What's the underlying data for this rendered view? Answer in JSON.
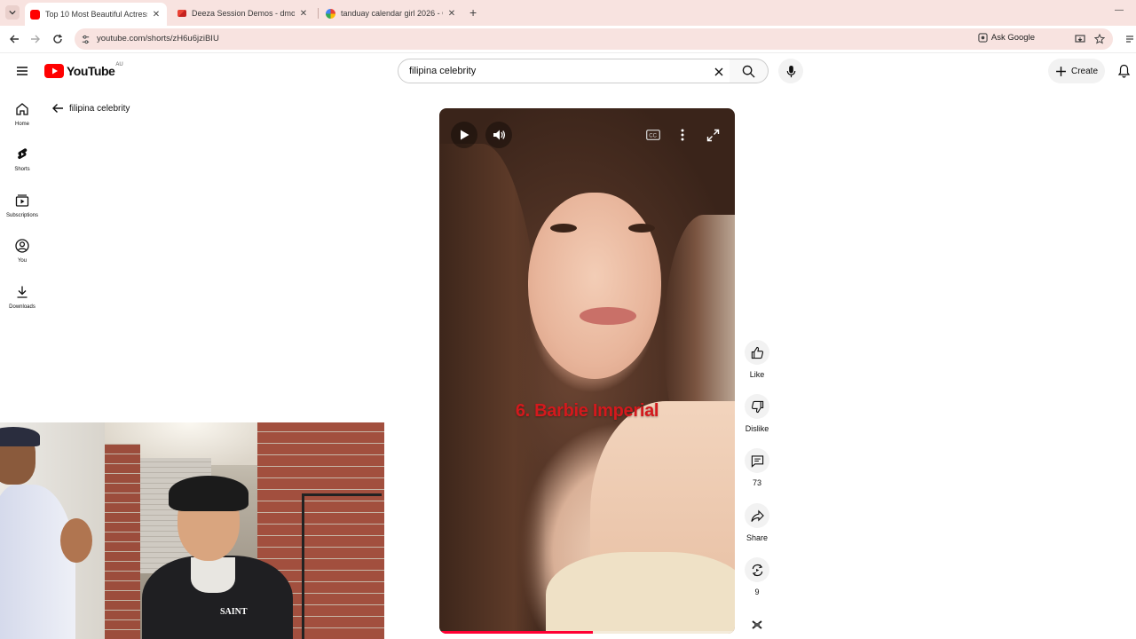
{
  "browser": {
    "tabs": [
      {
        "title": "Top 10 Most Beautiful Actress i",
        "favicon": "youtube-favicon",
        "active": true
      },
      {
        "title": "Deeza Session Demos - dmosu",
        "favicon": "gmail-favicon",
        "active": false
      },
      {
        "title": "tanduay calendar girl 2026 - Go",
        "favicon": "google-favicon",
        "active": false
      }
    ],
    "url": "youtube.com/shorts/zH6u6jziBIU",
    "ask_google_label": "Ask Google"
  },
  "header": {
    "logo_text": "YouTube",
    "logo_country": "AU",
    "search_value": "filipina celebrity",
    "create_label": "Create"
  },
  "sidebar": {
    "items": [
      {
        "label": "Home",
        "icon": "home-icon"
      },
      {
        "label": "Shorts",
        "icon": "shorts-icon"
      },
      {
        "label": "Subscriptions",
        "icon": "subscriptions-icon"
      },
      {
        "label": "You",
        "icon": "account-icon"
      },
      {
        "label": "Downloads",
        "icon": "download-icon"
      }
    ]
  },
  "back_link": {
    "label": "filipina celebrity"
  },
  "video": {
    "caption": "6. Barbie Imperial",
    "progress": 0.52,
    "accent_color": "#ff0033"
  },
  "actions": {
    "like_label": "Like",
    "dislike_label": "Dislike",
    "comments_count": "73",
    "share_label": "Share",
    "remix_count": "9"
  },
  "webcam": {
    "shirt_text": "SAINT"
  }
}
